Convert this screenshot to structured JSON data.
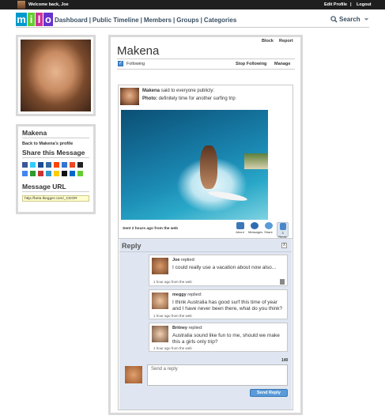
{
  "topbar": {
    "welcome": "Welcome back, Joe",
    "edit_profile": "Edit Profile",
    "separator": "|",
    "logout": "Logout"
  },
  "logo": {
    "letters": [
      "m",
      "i",
      "l",
      "o"
    ]
  },
  "nav": {
    "items": [
      "Dashboard",
      "Public Timeline",
      "Members",
      "Groups",
      "Categories"
    ],
    "separator": "|"
  },
  "search": {
    "label": "Search"
  },
  "sidebar": {
    "name": "Makena",
    "back_link": "Back to Makena's profile",
    "share_heading": "Share this Message",
    "url_heading": "Message URL",
    "url_value": "http://beta.lkegger.com/_CDOR"
  },
  "profile": {
    "block": "Block",
    "report": "Report",
    "name": "Makena",
    "following_label": "Following",
    "stop_following": "Stop Following",
    "manage": "Manage"
  },
  "post": {
    "author": "Makena",
    "said_text": "said to everyone publicly:",
    "photo_label": "Photo:",
    "photo_caption": "definitely time for another surfing trip",
    "sent_time": "Sent 2 hours ago from the web",
    "actions": {
      "about": "About",
      "messages": "Messages",
      "share": "Share",
      "reply": "Reply",
      "reply_count": "3"
    }
  },
  "reply_panel": {
    "title": "Reply",
    "close": "X",
    "replies": [
      {
        "name": "Joe",
        "verb": "replied:",
        "text": "I could really use a vacation about now also...",
        "time": "1 hour ago from the web"
      },
      {
        "name": "meggy",
        "verb": "replied:",
        "text": "I think Australia has good surf this time of year and I have never been there, what do you think?",
        "time": "1 hour ago from the web"
      },
      {
        "name": "Britney",
        "verb": "replied:",
        "text": "Australia sound like fun to me, should we make this a girls only trip?",
        "time": "1 hour ago from the web"
      }
    ],
    "char_count": "140",
    "input_placeholder": "Send a reply",
    "send_button": "Send Reply"
  },
  "colors": {
    "logo": [
      "#0099cc",
      "#66cc33",
      "#cc3399",
      "#6633cc"
    ],
    "accent": "#5a9bd9"
  },
  "icons": {
    "share_icons": [
      "facebook-icon",
      "twitter-icon",
      "myspace-icon",
      "digg-icon",
      "reddit-icon",
      "delicious-icon",
      "stumbleupon-icon",
      "yahoo-icon",
      "google-icon",
      "technorati-icon",
      "newsvine-icon",
      "furl-icon",
      "blinklist-icon",
      "spurl-icon",
      "simpy-icon",
      "live-icon"
    ]
  }
}
